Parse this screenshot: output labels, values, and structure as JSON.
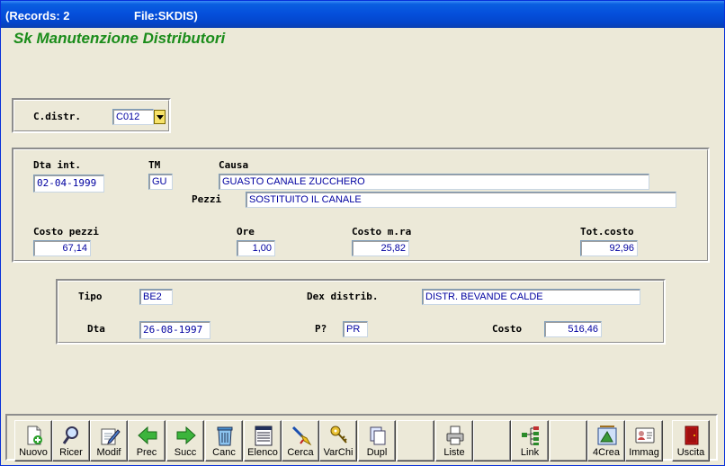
{
  "window": {
    "records": "(Records: 2",
    "file": "File:SKDIS)"
  },
  "form_title": "Sk Manutenzione Distributori",
  "distributore": {
    "label": "C.distr.",
    "value": "C012"
  },
  "intervento": {
    "dta_int_label": "Dta int.",
    "dta_int_value": "02-04-1999",
    "tm_label": "TM",
    "tm_value": "GU",
    "causa_label": "Causa",
    "causa_value": "GUASTO CANALE ZUCCHERO",
    "pezzi_label": "Pezzi",
    "pezzi_value": "SOSTITUITO IL CANALE",
    "costo_pezzi_label": "Costo pezzi",
    "costo_pezzi_value": "67,14",
    "ore_label": "Ore",
    "ore_value": "1,00",
    "costo_mra_label": "Costo m.ra",
    "costo_mra_value": "25,82",
    "tot_costo_label": "Tot.costo",
    "tot_costo_value": "92,96"
  },
  "dettaglio": {
    "tipo_label": "Tipo",
    "tipo_value": "BE2",
    "dex_label": "Dex distrib.",
    "dex_value": "DISTR. BEVANDE CALDE",
    "dta_label": "Dta",
    "dta_value": "26-08-1997",
    "p_label": "P?",
    "p_value": "PR",
    "costo_label": "Costo",
    "costo_value": "516,46"
  },
  "toolbar": {
    "nuovo": "Nuovo",
    "ricer": "Ricer",
    "modif": "Modif",
    "prec": "Prec",
    "succ": "Succ",
    "canc": "Canc",
    "elenco": "Elenco",
    "cerca": "Cerca",
    "varchi": "VarChi",
    "dupl": "Dupl",
    "liste": "Liste",
    "link": "Link",
    "crea4": "4Crea",
    "immag": "Immag",
    "uscita": "Uscita"
  },
  "icons": {
    "nuovo": "new-doc-icon",
    "ricer": "magnifier-icon",
    "modif": "edit-icon",
    "prec": "arrow-left-icon",
    "succ": "arrow-right-icon",
    "canc": "trash-icon",
    "elenco": "list-icon",
    "cerca": "brush-icon",
    "varchi": "key-icon",
    "dupl": "copy-icon",
    "liste": "printer-icon",
    "link": "tree-icon",
    "crea4": "wizard-icon",
    "immag": "id-card-icon",
    "uscita": "exit-door-icon"
  },
  "colors": {
    "title_green": "#1a8c1a",
    "field_text": "#0000a0",
    "titlebar": "#0550dc"
  }
}
